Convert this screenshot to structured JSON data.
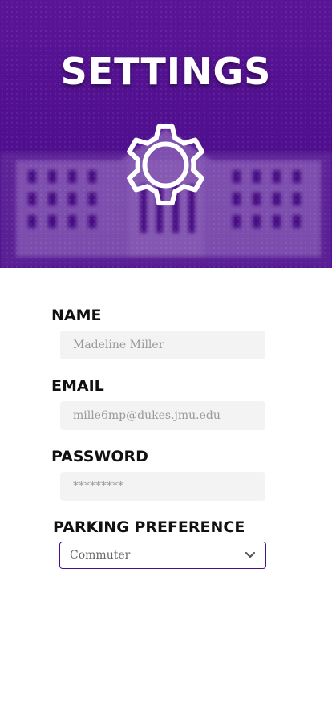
{
  "header": {
    "title": "SETTINGS",
    "icon": "gear-icon",
    "background_color": "#4f0f8e"
  },
  "form": {
    "name": {
      "label": "NAME",
      "value": "Madeline Miller"
    },
    "email": {
      "label": "EMAIL",
      "value": "mille6mp@dukes.jmu.edu"
    },
    "password": {
      "label": "PASSWORD",
      "value": "*********"
    },
    "parking": {
      "label": "PARKING PREFERENCE",
      "selected": "Commuter",
      "icon": "chevron-down-icon"
    }
  },
  "colors": {
    "accent": "#4b0f85",
    "field_background": "#f3f3f3",
    "placeholder_text": "#9a9a9a"
  }
}
